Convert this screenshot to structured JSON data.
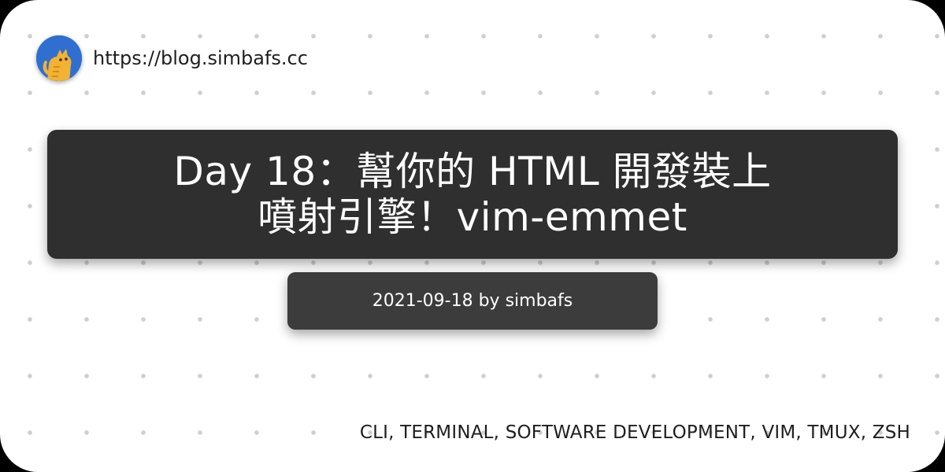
{
  "site": {
    "url": "https://blog.simbafs.cc",
    "avatar_icon": "cat-avatar-icon"
  },
  "post": {
    "title_line1": "Day 18：幫你的 HTML 開發裝上",
    "title_line2": "噴射引擎！vim-emmet",
    "meta": "2021-09-18 by simbafs",
    "tags": "CLI, TERMINAL, SOFTWARE DEVELOPMENT, VIM, TMUX, ZSH"
  },
  "colors": {
    "background": "#ffffff",
    "dots": "#cfcfcf",
    "title_box": "#2f2f2f",
    "meta_box": "#3c3c3c",
    "avatar_bg": "#2f6fd0",
    "cat": "#f2b233"
  }
}
